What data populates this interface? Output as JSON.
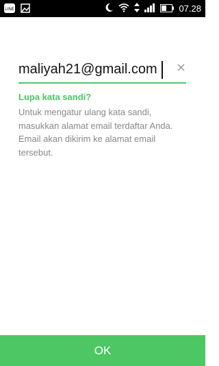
{
  "status_bar": {
    "time": "07.28",
    "left_icons": [
      "line-app-icon",
      "image-icon"
    ],
    "right_icons": [
      "moon-icon",
      "wifi-icon",
      "data-arrows-icon",
      "signal-icon",
      "battery-icon"
    ]
  },
  "form": {
    "email_value": "maliyah21@gmail.com",
    "title": "Lupa kata sandi?",
    "description": "Untuk mengatur ulang kata sandi, masukkan alamat email terdaftar Anda. Email akan dikirim ke alamat email tersebut."
  },
  "footer": {
    "ok_label": "OK"
  },
  "colors": {
    "accent": "#4cc764",
    "text": "#111111",
    "muted": "#888888",
    "status_bg": "#000000"
  }
}
